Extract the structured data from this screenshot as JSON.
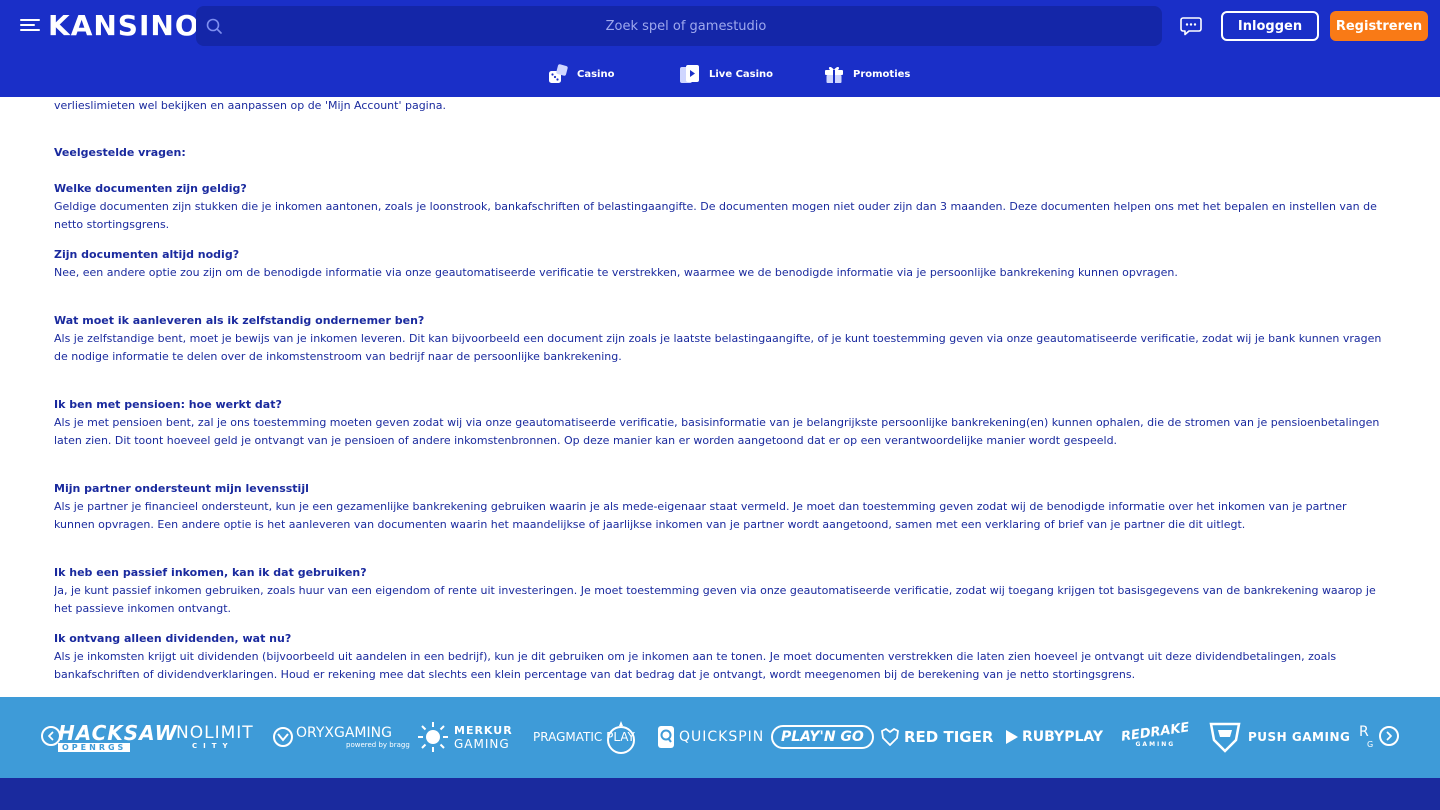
{
  "header": {
    "logo": "KANSINO",
    "search_placeholder": "Zoek spel of gamestudio",
    "login_label": "Inloggen",
    "register_label": "Registreren",
    "accent_color": "#f97a16",
    "header_color": "#1a2fc8"
  },
  "nav": {
    "items": [
      {
        "label": "Casino",
        "icon": "dice-icon"
      },
      {
        "label": "Live Casino",
        "icon": "cards-icon"
      },
      {
        "label": "Promoties",
        "icon": "gift-icon"
      }
    ]
  },
  "content": {
    "intro_tail": "verlieslimieten wel bekijken en aanpassen op de 'Mijn Account' pagina.",
    "faq_heading": "Veelgestelde vragen:",
    "faqs": [
      {
        "q": "Welke documenten zijn geldig?",
        "a": "Geldige documenten zijn stukken die je inkomen aantonen, zoals je loonstrook, bankafschriften of belastingaangifte. De documenten mogen niet ouder zijn dan 3 maanden. Deze documenten helpen ons met het bepalen en instellen van de netto stortingsgrens."
      },
      {
        "q": "Zijn documenten altijd nodig?",
        "a": "Nee, een andere optie zou zijn om de benodigde informatie via onze geautomatiseerde verificatie te verstrekken, waarmee we de benodigde informatie via je persoonlijke bankrekening kunnen opvragen."
      },
      {
        "q": "Wat moet ik aanleveren als ik zelfstandig ondernemer ben?",
        "a": "Als je zelfstandige bent, moet je bewijs van je inkomen leveren. Dit kan bijvoorbeeld een document zijn zoals je laatste belastingaangifte, of je kunt toestemming geven via onze geautomatiseerde verificatie, zodat wij je bank kunnen vragen de nodige informatie te delen over de inkomstenstroom van bedrijf naar de persoonlijke bankrekening."
      },
      {
        "q": "Ik ben met pensioen: hoe werkt dat?",
        "a": "Als je met pensioen bent, zal je ons toestemming moeten geven zodat wij via onze geautomatiseerde verificatie, basisinformatie van je belangrijkste persoonlijke bankrekening(en) kunnen ophalen, die de stromen van je pensioenbetalingen laten zien. Dit toont hoeveel geld je ontvangt van je pensioen of andere inkomstenbronnen. Op deze manier kan er worden aangetoond dat er op een verantwoordelijke manier wordt gespeeld."
      },
      {
        "q": "Mijn partner ondersteunt mijn levensstijl",
        "a": "Als je partner je financieel ondersteunt, kun je een gezamenlijke bankrekening gebruiken waarin je als mede-eigenaar staat vermeld. Je moet dan toestemming geven zodat wij de benodigde informatie over het inkomen van je partner kunnen opvragen. Een andere optie is het aanleveren van documenten waarin het maandelijkse of jaarlijkse inkomen van je partner wordt aangetoond, samen met een verklaring of brief van je partner die dit uitlegt."
      },
      {
        "q": "Ik heb een passief inkomen, kan ik dat gebruiken?",
        "a": "Ja, je kunt passief inkomen gebruiken, zoals huur van een eigendom of rente uit investeringen. Je moet toestemming geven via onze geautomatiseerde verificatie, zodat wij toegang krijgen tot basisgegevens van de bankrekening waarop je het passieve inkomen ontvangt."
      },
      {
        "q": "Ik ontvang alleen dividenden, wat nu?",
        "a": "Als je inkomsten krijgt uit dividenden (bijvoorbeeld uit aandelen in een bedrijf), kun je dit gebruiken om je inkomen aan te tonen. Je moet documenten verstrekken die laten zien hoeveel je ontvangt uit deze dividendbetalingen, zoals bankafschriften of dividendverklaringen. Houd er rekening mee dat slechts een klein percentage van dat bedrag dat je ontvangt, wordt meegenomen bij de berekening van je netto stortingsgrens."
      }
    ]
  },
  "providers": {
    "items": [
      {
        "name": "HACKSAW",
        "sub": "OPENRGS"
      },
      {
        "name": "NOLIMIT",
        "sub": "CITY"
      },
      {
        "name": "ORYXGAMING",
        "sub": "powered by bragg"
      },
      {
        "name": "MERKUR",
        "sub": "GAMING"
      },
      {
        "name": "PRAGMATIC PLAY",
        "sub": ""
      },
      {
        "name": "QUICKSPIN",
        "sub": ""
      },
      {
        "name": "PLAY'N GO",
        "sub": ""
      },
      {
        "name": "RED TIGER",
        "sub": ""
      },
      {
        "name": "RUBYPLAY",
        "sub": ""
      },
      {
        "name": "REDRAKE",
        "sub": "GAMING"
      },
      {
        "name": "PUSH GAMING",
        "sub": ""
      },
      {
        "name": "R",
        "sub": "G"
      }
    ],
    "strip_color": "#3e9bd8"
  }
}
